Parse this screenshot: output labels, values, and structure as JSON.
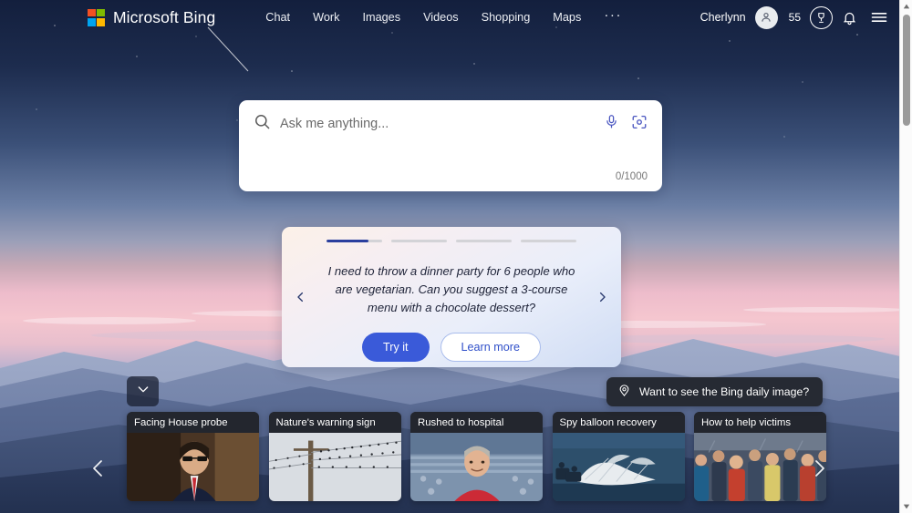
{
  "header": {
    "brand": "Microsoft Bing",
    "logo_icon": "microsoft-logo-icon",
    "nav": [
      {
        "label": "Chat"
      },
      {
        "label": "Work"
      },
      {
        "label": "Images"
      },
      {
        "label": "Videos"
      },
      {
        "label": "Shopping"
      },
      {
        "label": "Maps"
      }
    ],
    "more_label": "···",
    "username": "Cherlynn",
    "avatar_icon": "person-avatar-icon",
    "points": "55",
    "rewards_icon": "rewards-trophy-icon",
    "notifications_icon": "bell-icon",
    "menu_icon": "hamburger-menu-icon"
  },
  "search": {
    "placeholder": "Ask me anything...",
    "value": "",
    "counter": "0/1000",
    "search_icon": "search-icon",
    "mic_icon": "microphone-icon",
    "visual_search_icon": "visual-search-camera-icon"
  },
  "suggestion": {
    "prompt": "I need to throw a dinner party for 6 people who are vegetarian. Can you suggest a 3-course menu with a chocolate dessert?",
    "try_label": "Try it",
    "learn_label": "Learn more",
    "prev_icon": "chevron-left-icon",
    "next_icon": "chevron-right-icon",
    "segments": 4,
    "active_segment": 0,
    "accent_color": "#2a3f9e",
    "primary_button_color": "#3a5ad9"
  },
  "daily_image_pill": {
    "label": "Want to see the Bing daily image?",
    "icon": "location-pin-icon"
  },
  "expand_button": {
    "icon": "chevron-down-icon"
  },
  "news": {
    "prev_icon": "chevron-left-icon",
    "next_icon": "chevron-right-icon",
    "cards": [
      {
        "title": "Facing House probe"
      },
      {
        "title": "Nature's warning sign"
      },
      {
        "title": "Rushed to hospital"
      },
      {
        "title": "Spy balloon recovery"
      },
      {
        "title": "How to help victims"
      }
    ]
  },
  "scrollbar": {
    "up_icon": "scroll-up-arrow-icon",
    "down_icon": "scroll-down-arrow-icon"
  }
}
